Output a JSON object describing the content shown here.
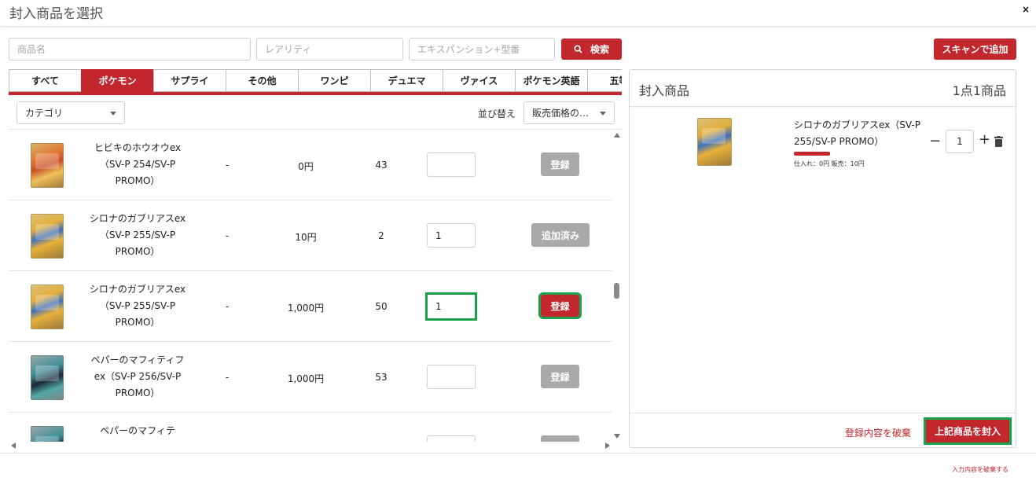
{
  "modal": {
    "title": "封入商品を選択",
    "close_label": "×"
  },
  "search": {
    "name_placeholder": "商品名",
    "rarity_placeholder": "レアリティ",
    "expansion_placeholder": "エキスパンション+型番",
    "search_label": "検索",
    "scan_label": "スキャンで追加"
  },
  "tabs": [
    {
      "label": "すべて",
      "active": false
    },
    {
      "label": "ポケモン",
      "active": true
    },
    {
      "label": "サプライ",
      "active": false
    },
    {
      "label": "その他",
      "active": false
    },
    {
      "label": "ワンピ",
      "active": false
    },
    {
      "label": "デュエマ",
      "active": false
    },
    {
      "label": "ヴァイス",
      "active": false
    },
    {
      "label": "ポケモン英語",
      "active": false
    },
    {
      "label": "五等分",
      "active": false
    }
  ],
  "filters": {
    "category_label": "カテゴリ",
    "sort_label": "並び替え",
    "sort_value": "販売価格の…"
  },
  "rows": [
    {
      "name": "ヒビキのホウオウex（SV-P 254/SV-P PROMO）",
      "col2": "-",
      "price": "0円",
      "stock": "43",
      "qty": "",
      "action": "登録",
      "action_state": "disabled",
      "card": "fire"
    },
    {
      "name": "シロナのガブリアスex（SV-P 255/SV-P PROMO）",
      "col2": "-",
      "price": "10円",
      "stock": "2",
      "qty": "1",
      "action": "追加済み",
      "action_state": "added",
      "card": "gold"
    },
    {
      "name": "シロナのガブリアスex（SV-P 255/SV-P PROMO）",
      "col2": "-",
      "price": "1,000円",
      "stock": "50",
      "qty": "1",
      "action": "登録",
      "action_state": "active",
      "card": "gold"
    },
    {
      "name": "ペパーのマフィティフex（SV-P 256/SV-P PROMO）",
      "col2": "-",
      "price": "1,000円",
      "stock": "53",
      "qty": "",
      "action": "登録",
      "action_state": "disabled",
      "card": "teal"
    },
    {
      "name": "ペパーのマフィテ",
      "col2": "",
      "price": "",
      "stock": "",
      "qty": "",
      "action": "",
      "action_state": "disabled",
      "card": "teal"
    }
  ],
  "selected_panel": {
    "title": "封入商品",
    "count_text": "1点1商品",
    "item": {
      "name": "シロナのガブリアスex（SV-P 255/SV-P PROMO）",
      "price_text": "仕入れ：0円 販売：10円",
      "qty": "1"
    },
    "discard_label": "登録内容を破棄",
    "seal_label": "上記商品を封入"
  },
  "footer": {
    "discard_input_label": "入力内容を破棄する"
  },
  "colors": {
    "accent": "#c1272d",
    "highlight": "#19a24a",
    "disabled": "#a9a9a9"
  },
  "icons": [
    "search-icon",
    "close-icon",
    "chevron-down-icon",
    "minus-icon",
    "plus-icon",
    "trash-icon"
  ]
}
